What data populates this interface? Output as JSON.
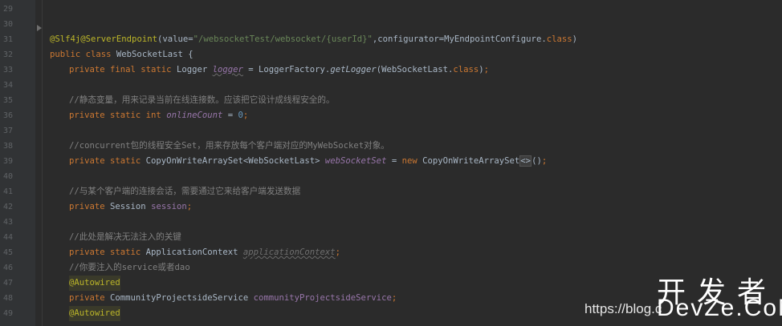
{
  "editor": {
    "line_numbers": [
      "29",
      "30",
      "31",
      "32",
      "33",
      "34",
      "35",
      "36",
      "37",
      "38",
      "39",
      "40",
      "41",
      "42",
      "43",
      "44",
      "45",
      "46",
      "47",
      "48",
      "49"
    ],
    "code": {
      "l30": {
        "annot": "@ServerEndpoint",
        "p1": "(value=",
        "str": "\"/websocketTest/websocket/{userId}\"",
        "p2": ",configurator=MyEndpointConfigure.",
        "kw": "class",
        "p3": ")"
      },
      "l31": {
        "annot": "@Slf4j"
      },
      "l32": {
        "kw": "public class",
        "rest": " WebSocketLast {"
      },
      "l33": {
        "kw": "private final static",
        "t1": " Logger ",
        "field": "logger",
        "t2": " = LoggerFactory.",
        "method": "getLogger",
        "t3": "(WebSocketLast.",
        "kw2": "class",
        "t4": ")",
        "semi": ";"
      },
      "l35": {
        "comment": "//静态变量，用来记录当前在线连接数。应该把它设计成线程安全的。"
      },
      "l36": {
        "kw": "private static int",
        "t1": " ",
        "field": "onlineCount",
        "t2": " = ",
        "num": "0",
        "semi": ";"
      },
      "l38": {
        "comment": "//concurrent包的线程安全Set，用来存放每个客户端对应的MyWebSocket对象。"
      },
      "l39": {
        "kw": "private static",
        "t1": " CopyOnWriteArraySet<WebSocketLast> ",
        "field": "webSocketSet",
        "t2": " = ",
        "kw2": "new",
        "t3": " CopyOnWriteArraySet",
        "diamond": "<>",
        "t4": "()",
        "semi": ";"
      },
      "l41": {
        "comment": "//与某个客户端的连接会话，需要通过它来给客户端发送数据"
      },
      "l42": {
        "kw": "private",
        "t1": " Session ",
        "field": "session",
        "semi": ";"
      },
      "l44": {
        "comment": "//此处是解决无法注入的关键"
      },
      "l45": {
        "kw": "private static",
        "t1": " ApplicationContext ",
        "field": "applicationContext",
        "semi": ";"
      },
      "l46": {
        "comment": "//你要注入的service或者dao"
      },
      "l47": {
        "annot": "@Autowired"
      },
      "l48": {
        "kw": "private",
        "t1": " CommunityProjectsideService ",
        "field": "communityProjectsideService",
        "semi": ";"
      },
      "l49": {
        "annot": "@Autowired"
      }
    }
  },
  "watermark": {
    "url": "https://blog.c",
    "logo_cn": "开发者",
    "logo_en": "DevZe.CoM"
  },
  "colors": {
    "background": "#2b2b2b",
    "keyword": "#cc7832",
    "annotation": "#bbb529",
    "string": "#6a8759",
    "field": "#9876aa",
    "comment": "#808080",
    "number": "#6897bb",
    "text": "#a9b7c6"
  }
}
